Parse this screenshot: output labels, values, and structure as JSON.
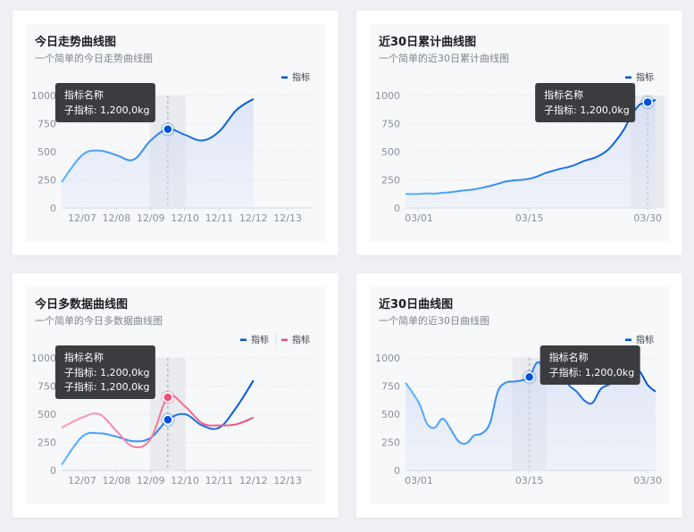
{
  "colors": {
    "primary": "#0052d9",
    "primary_light": "#5ab4ff",
    "secondary": "#e8507a",
    "secondary_light": "#ff9bb5",
    "grid": "#e3e5ea",
    "hover_band": "#e6e7ea"
  },
  "tooltip": {
    "title": "指标名称",
    "row": "子指标: 1,200,0kg"
  },
  "chart_data": [
    {
      "type": "line",
      "title": "今日走势曲线图",
      "subtitle": "一个简单的今日走势曲线图",
      "area": true,
      "ylim": [
        0,
        1000
      ],
      "yticks": [
        0,
        250,
        500,
        750,
        1000
      ],
      "categories": [
        "12/07",
        "12/08",
        "12/09",
        "12/10",
        "12/11",
        "12/12",
        "12/13"
      ],
      "x_pad_left": 0.06,
      "x_max": 6.7,
      "series": [
        {
          "name": "指标",
          "x": [
            -0.6,
            0,
            0.5,
            1,
            1.5,
            2,
            2.5,
            3,
            3.5,
            4,
            4.5,
            5
          ],
          "values": [
            230,
            470,
            510,
            470,
            430,
            600,
            700,
            650,
            600,
            680,
            870,
            970
          ]
        }
      ],
      "legend": [
        "指标"
      ],
      "highlight_index": 5,
      "tooltip_rows": 1
    },
    {
      "type": "line",
      "title": "近30日累计曲线图",
      "subtitle": "一个简单的近30日累计曲线图",
      "area": true,
      "ylim": [
        0,
        1000
      ],
      "yticks": [
        0,
        250,
        500,
        750,
        1000
      ],
      "categories": [
        "03/01",
        "03/15",
        "03/30"
      ],
      "tick_x": [
        0,
        14,
        29
      ],
      "x_min": -1.7,
      "x_max": 30,
      "series": [
        {
          "name": "指标",
          "x": [
            -1.7,
            0,
            1,
            2,
            3,
            4,
            5,
            6,
            7,
            8,
            9,
            10,
            11,
            12,
            13,
            14,
            15,
            16,
            17,
            18,
            19,
            20,
            21,
            22,
            23,
            24,
            25,
            26,
            27,
            28,
            29,
            30
          ],
          "values": [
            125,
            125,
            130,
            128,
            135,
            140,
            150,
            158,
            165,
            180,
            195,
            215,
            235,
            245,
            250,
            260,
            280,
            310,
            330,
            350,
            365,
            390,
            420,
            440,
            470,
            520,
            600,
            700,
            830,
            920,
            940,
            960
          ]
        }
      ],
      "legend": [
        "指标"
      ],
      "highlight_index": 29,
      "tooltip_rows": 1
    },
    {
      "type": "line",
      "title": "今日多数据曲线图",
      "subtitle": "一个简单的今日多数据曲线图",
      "area": false,
      "ylim": [
        0,
        1000
      ],
      "yticks": [
        0,
        250,
        500,
        750,
        1000
      ],
      "categories": [
        "12/07",
        "12/08",
        "12/09",
        "12/10",
        "12/11",
        "12/12",
        "12/13"
      ],
      "x_pad_left": 0.06,
      "x_max": 6.7,
      "series": [
        {
          "name": "指标",
          "x": [
            -0.6,
            0,
            0.5,
            1,
            1.5,
            2,
            2.5,
            3,
            3.5,
            4,
            4.5,
            5
          ],
          "values": [
            50,
            300,
            330,
            300,
            260,
            290,
            450,
            500,
            400,
            380,
            560,
            800
          ]
        },
        {
          "name": "指标",
          "x": [
            -0.6,
            0,
            0.5,
            1,
            1.5,
            2,
            2.5,
            3,
            3.5,
            4,
            4.5,
            5
          ],
          "values": [
            380,
            470,
            500,
            350,
            210,
            280,
            650,
            570,
            420,
            400,
            410,
            470
          ]
        }
      ],
      "legend": [
        "指标",
        "指标"
      ],
      "highlight_index": 5,
      "tooltip_rows": 2
    },
    {
      "type": "line",
      "title": "近30日曲线图",
      "subtitle": "一个简单的近30日曲线图",
      "area": true,
      "ylim": [
        0,
        1000
      ],
      "yticks": [
        0,
        250,
        500,
        750,
        1000
      ],
      "categories": [
        "03/01",
        "03/15",
        "03/30"
      ],
      "tick_x": [
        0,
        14,
        29
      ],
      "x_min": -1.7,
      "x_max": 30,
      "series": [
        {
          "name": "指标",
          "x": [
            -1.7,
            0,
            1,
            2,
            3,
            4,
            5,
            6,
            7,
            8,
            9,
            10,
            11,
            12,
            13,
            14,
            15,
            16,
            17,
            18,
            19,
            20,
            21,
            22,
            23,
            24,
            25,
            26,
            27,
            28,
            29,
            30
          ],
          "values": [
            780,
            600,
            420,
            380,
            460,
            370,
            260,
            240,
            310,
            330,
            420,
            700,
            780,
            790,
            800,
            830,
            960,
            900,
            820,
            870,
            760,
            700,
            620,
            600,
            720,
            760,
            800,
            870,
            920,
            880,
            760,
            700
          ]
        }
      ],
      "legend": [
        "指标"
      ],
      "highlight_index": 14,
      "tooltip_rows": 1
    }
  ]
}
